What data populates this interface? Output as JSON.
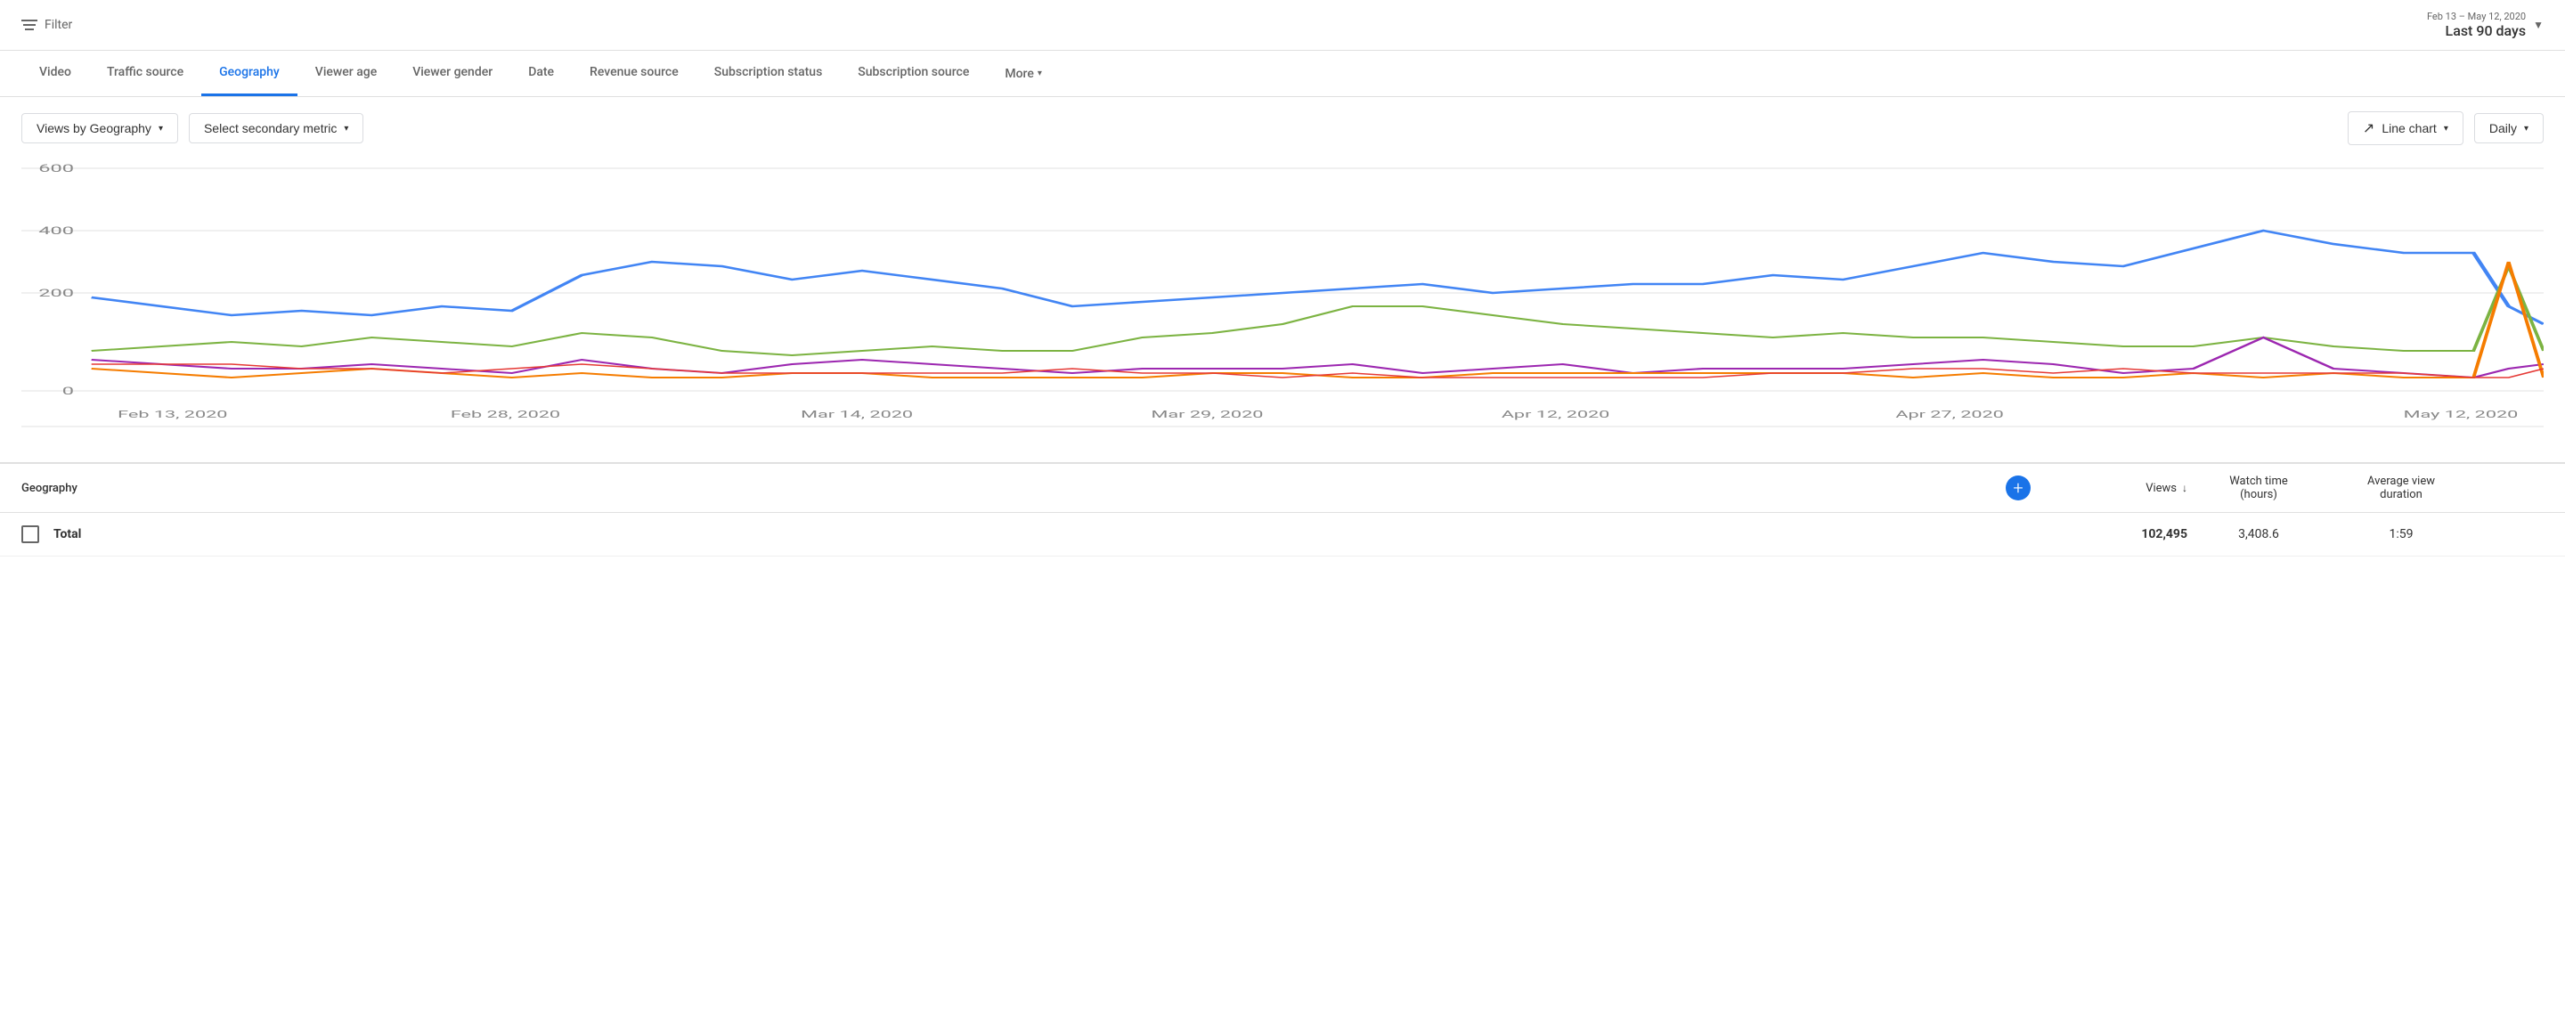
{
  "filter": {
    "label": "Filter",
    "icon": "filter-icon"
  },
  "dateRange": {
    "sub": "Feb 13 – May 12, 2020",
    "main": "Last 90 days"
  },
  "tabs": [
    {
      "id": "video",
      "label": "Video",
      "active": false
    },
    {
      "id": "traffic-source",
      "label": "Traffic source",
      "active": false
    },
    {
      "id": "geography",
      "label": "Geography",
      "active": true
    },
    {
      "id": "viewer-age",
      "label": "Viewer age",
      "active": false
    },
    {
      "id": "viewer-gender",
      "label": "Viewer gender",
      "active": false
    },
    {
      "id": "date",
      "label": "Date",
      "active": false
    },
    {
      "id": "revenue-source",
      "label": "Revenue source",
      "active": false
    },
    {
      "id": "subscription-status",
      "label": "Subscription status",
      "active": false
    },
    {
      "id": "subscription-source",
      "label": "Subscription source",
      "active": false
    }
  ],
  "more": {
    "label": "More"
  },
  "controls": {
    "primary_metric": "Views by Geography",
    "secondary_metric": "Select secondary metric",
    "chart_type": "Line chart",
    "frequency": "Daily"
  },
  "chart": {
    "y_labels": [
      "600",
      "400",
      "200",
      "0"
    ],
    "x_labels": [
      "Feb 13, 2020",
      "Feb 28, 2020",
      "Mar 14, 2020",
      "Mar 29, 2020",
      "Apr 12, 2020",
      "Apr 27, 2020",
      "May 12, 2020"
    ],
    "colors": {
      "blue": "#4285f4",
      "green": "#7cb342",
      "purple": "#9c27b0",
      "orange": "#f57c00",
      "red": "#e53935"
    }
  },
  "table": {
    "headers": {
      "geography": "Geography",
      "views": "Views",
      "watch_time": "Watch time\n(hours)",
      "avg_duration": "Average view\nduration"
    },
    "rows": [
      {
        "label": "Total",
        "views": "102,495",
        "watch_time": "3,408.6",
        "avg_duration": "1:59"
      }
    ]
  }
}
